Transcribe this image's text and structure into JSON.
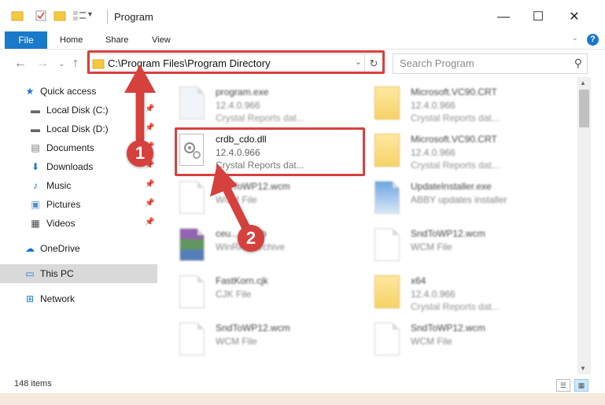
{
  "window": {
    "title": "Program",
    "controls": {
      "minimize": "—",
      "maximize": "☐",
      "close": "✕"
    }
  },
  "ribbon": {
    "tabs": [
      "File",
      "Home",
      "Share",
      "View"
    ],
    "help": "?"
  },
  "navbar": {
    "back": "←",
    "forward": "→",
    "up": "↑",
    "address": "C:\\Program Files\\Program Directory",
    "search_placeholder": "Search Program"
  },
  "sidebar": {
    "items": [
      {
        "label": "Quick access",
        "icon": "star-icon"
      },
      {
        "label": "Local Disk (C:)",
        "icon": "drive-icon",
        "pinned": true
      },
      {
        "label": "Local Disk (D:)",
        "icon": "drive-icon",
        "pinned": true
      },
      {
        "label": "Documents",
        "icon": "documents-icon",
        "pinned": true
      },
      {
        "label": "Downloads",
        "icon": "download-icon",
        "pinned": true
      },
      {
        "label": "Music",
        "icon": "music-icon",
        "pinned": true
      },
      {
        "label": "Pictures",
        "icon": "pictures-icon",
        "pinned": true
      },
      {
        "label": "Videos",
        "icon": "videos-icon",
        "pinned": true
      },
      {
        "label": "OneDrive",
        "icon": "cloud-icon"
      },
      {
        "label": "This PC",
        "icon": "computer-icon"
      },
      {
        "label": "Network",
        "icon": "network-icon"
      }
    ]
  },
  "files": [
    {
      "name": "program.exe",
      "version": "12.4.0.966",
      "type": "Crystal Reports dat...",
      "icon": "exe-icon"
    },
    {
      "name": "Microsoft.VC90.CRT",
      "version": "12.4.0.966",
      "type": "Crystal Reports dat...",
      "icon": "folder-icon"
    },
    {
      "name": "crdb_cdo.dll",
      "version": "12.4.0.966",
      "type": "Crystal Reports dat...",
      "icon": "dll-icon"
    },
    {
      "name": "Microsoft.VC90.CRT",
      "version": "12.4.0.966",
      "type": "Crystal Reports dat...",
      "icon": "folder-icon"
    },
    {
      "name": "SndToWP12.wcm",
      "version": "WCM File",
      "type": "",
      "icon": "file-icon"
    },
    {
      "name": "UpdateInstaller.exe",
      "version": "ABBY updates installer",
      "type": "",
      "icon": "installer-icon"
    },
    {
      "name": "ceu...ns.cab",
      "version": "WinRAR archive",
      "type": "",
      "icon": "archive-icon"
    },
    {
      "name": "SndToWP12.wcm",
      "version": "WCM File",
      "type": "",
      "icon": "file-icon"
    },
    {
      "name": "FastKorn.cjk",
      "version": "CJK File",
      "type": "",
      "icon": "file-icon"
    },
    {
      "name": "x64",
      "version": "12.4.0.966",
      "type": "Crystal Reports dat...",
      "icon": "folder-icon"
    },
    {
      "name": "SndToWP12.wcm",
      "version": "WCM File",
      "type": "",
      "icon": "file-icon"
    },
    {
      "name": "SndToWP12.wcm",
      "version": "WCM File",
      "type": "",
      "icon": "file-icon"
    }
  ],
  "status": {
    "count": "148 items"
  },
  "annotations": {
    "step1": "1",
    "step2": "2",
    "color": "#d6413d"
  }
}
